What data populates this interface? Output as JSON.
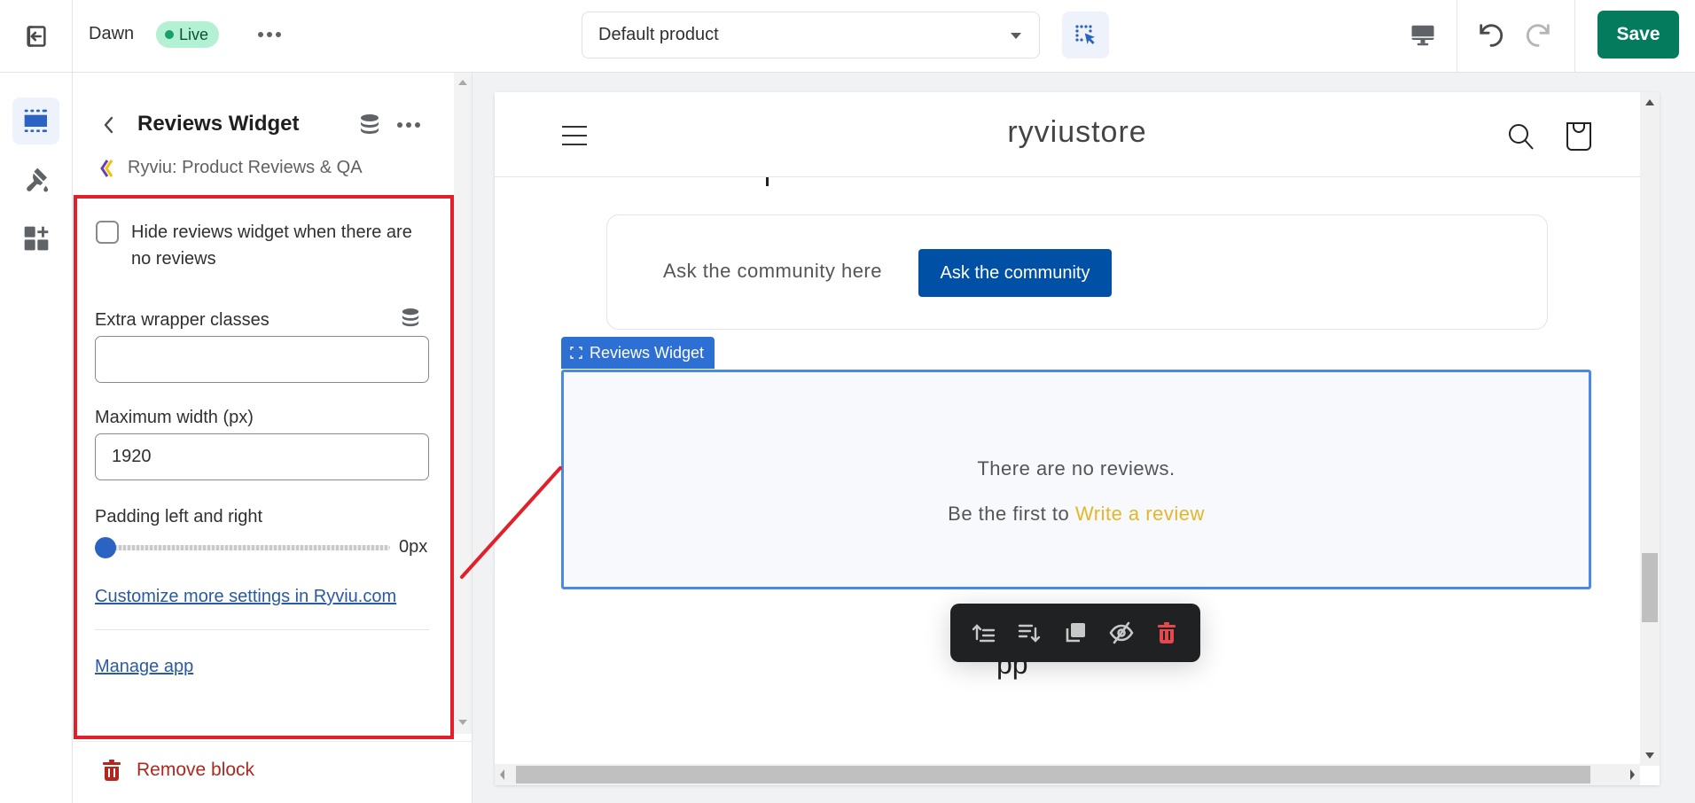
{
  "topbar": {
    "exit_icon": "exit-icon",
    "theme_name": "Dawn",
    "status_badge": "Live",
    "more_icon": "more-horizontal-icon",
    "template_select": "Default product",
    "inspector_icon": "inspector-select-icon",
    "device_icon": "desktop-icon",
    "undo_icon": "undo-icon",
    "redo_icon": "redo-icon",
    "save_label": "Save"
  },
  "rail": {
    "items": [
      {
        "icon": "sections-icon",
        "active": true
      },
      {
        "icon": "theme-settings-brush-icon",
        "active": false
      },
      {
        "icon": "add-app-blocks-icon",
        "active": false
      }
    ]
  },
  "sidebar": {
    "title": "Reviews Widget",
    "app_name": "Ryviu: Product Reviews & QA",
    "settings": {
      "hide_checkbox_label": "Hide reviews widget when there are no reviews",
      "hide_checkbox_checked": false,
      "extra_classes_label": "Extra wrapper classes",
      "extra_classes_value": "",
      "max_width_label": "Maximum width (px)",
      "max_width_value": "1920",
      "padding_label": "Padding left and right",
      "padding_value": 0,
      "padding_value_text": "0px",
      "customize_link": "Customize more settings in Ryviu.com",
      "manage_app_link": "Manage app"
    },
    "remove_block_label": "Remove block"
  },
  "preview": {
    "store_name": "ryviustore",
    "community_text": "Ask the community here",
    "community_button": "Ask the community",
    "widget_tag": "Reviews Widget",
    "no_reviews_text": "There are no reviews.",
    "be_first_text": "Be the first to ",
    "write_review_link": "Write a review",
    "below_text_fragment": "pp",
    "toolbar": [
      {
        "icon": "move-up-icon",
        "label": "Move up"
      },
      {
        "icon": "move-down-icon",
        "label": "Move down"
      },
      {
        "icon": "duplicate-icon",
        "label": "Duplicate"
      },
      {
        "icon": "hide-icon",
        "label": "Hide"
      },
      {
        "icon": "delete-icon",
        "label": "Delete"
      }
    ]
  },
  "colors": {
    "save_green": "#047b5d",
    "accent_blue": "#2e6fd3",
    "annotation_red": "#e3202a",
    "community_button_blue": "#0050a5",
    "write_review_yellow": "#e3b62b",
    "remove_red": "#b3261e",
    "live_badge_bg": "#b4f0d4"
  }
}
